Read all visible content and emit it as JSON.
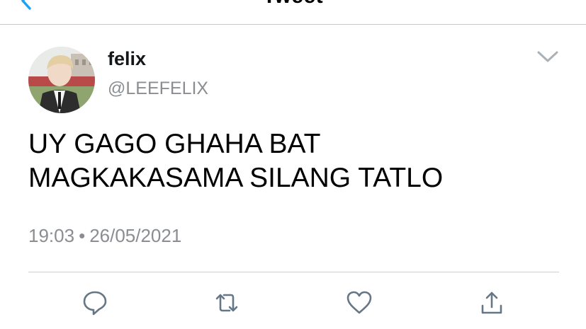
{
  "header": {
    "title": "Tweet",
    "back_icon": "chevron-left-icon"
  },
  "tweet": {
    "author": {
      "display_name": "felix",
      "handle": "@LEEFELIX"
    },
    "text_lines": [
      "UY GAGO GHAHA BAT",
      "MAGKAKASAMA SILANG TATLO"
    ],
    "time": "19:03",
    "separator": "•",
    "date": "26/05/2021"
  },
  "actions": [
    {
      "icon": "reply-icon"
    },
    {
      "icon": "retweet-icon"
    },
    {
      "icon": "like-icon"
    },
    {
      "icon": "share-icon"
    }
  ],
  "colors": {
    "accent": "#1da1f2",
    "icon_gray": "#657786",
    "secondary_text": "#8a8d91",
    "divider": "#cfcfcf"
  }
}
